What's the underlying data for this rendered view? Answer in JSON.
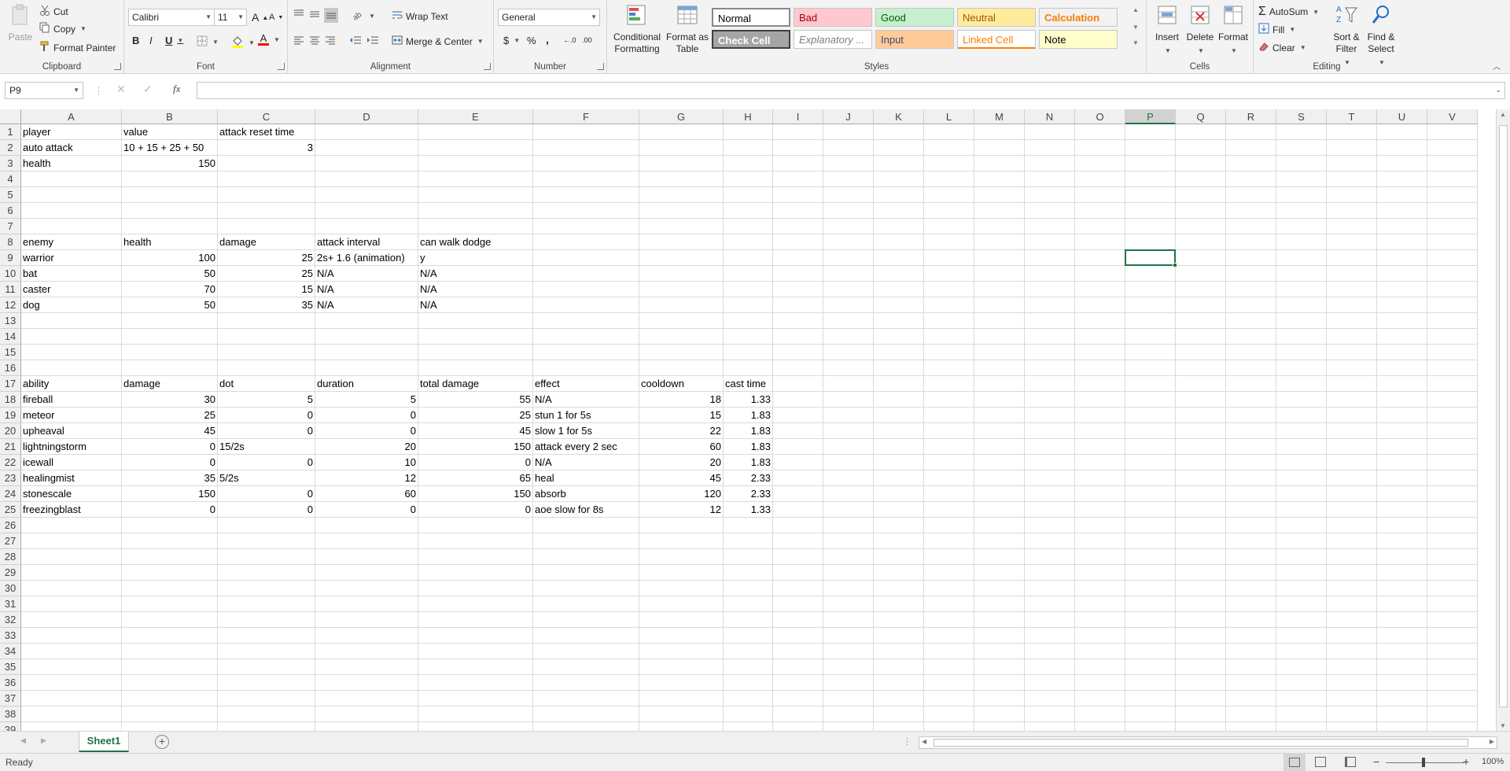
{
  "ribbon": {
    "clipboard": {
      "label": "Clipboard",
      "paste": "Paste",
      "cut": "Cut",
      "copy": "Copy",
      "format_painter": "Format Painter"
    },
    "font": {
      "label": "Font",
      "font_name": "Calibri",
      "font_size": "11",
      "bold": "B",
      "italic": "I",
      "underline": "U",
      "grow": "A",
      "shrink": "A",
      "font_color_glyph": "A"
    },
    "alignment": {
      "label": "Alignment",
      "wrap_text": "Wrap Text",
      "merge_center": "Merge & Center"
    },
    "number": {
      "label": "Number",
      "format": "General",
      "currency": "$",
      "percent": "%",
      "comma": ",",
      "inc_dec": "←.0",
      "dec_dec": ".00"
    },
    "styles": {
      "label": "Styles",
      "conditional": "Conditional Formatting",
      "format_table": "Format as Table",
      "cells": [
        {
          "name": "Normal",
          "bg": "#ffffff",
          "fg": "#000000"
        },
        {
          "name": "Bad",
          "bg": "#ffc7ce",
          "fg": "#9c0006"
        },
        {
          "name": "Good",
          "bg": "#c6efce",
          "fg": "#006100"
        },
        {
          "name": "Neutral",
          "bg": "#ffeb9c",
          "fg": "#9c5700"
        },
        {
          "name": "Calculation",
          "bg": "#f2f2f2",
          "fg": "#fa7d00"
        },
        {
          "name": "Check Cell",
          "bg": "#a5a5a5",
          "fg": "#ffffff"
        },
        {
          "name": "Explanatory ...",
          "bg": "#ffffff",
          "fg": "#7f7f7f"
        },
        {
          "name": "Input",
          "bg": "#ffcc99",
          "fg": "#3f3f76"
        },
        {
          "name": "Linked Cell",
          "bg": "#ffffff",
          "fg": "#fa7d00"
        },
        {
          "name": "Note",
          "bg": "#ffffcc",
          "fg": "#000000"
        }
      ]
    },
    "cells_group": {
      "label": "Cells",
      "insert": "Insert",
      "delete": "Delete",
      "format": "Format"
    },
    "editing": {
      "label": "Editing",
      "autosum": "AutoSum",
      "fill": "Fill",
      "clear": "Clear",
      "sort": "Sort & Filter",
      "find": "Find & Select"
    }
  },
  "formula_bar": {
    "name_box": "P9",
    "fx": "fx",
    "content": ""
  },
  "grid": {
    "columns": [
      "A",
      "B",
      "C",
      "D",
      "E",
      "F",
      "G",
      "H",
      "I",
      "J",
      "K",
      "L",
      "M",
      "N",
      "O",
      "P",
      "Q",
      "R",
      "S",
      "T",
      "U",
      "V"
    ],
    "selected_col": "P",
    "selected_cell": "P9",
    "rows": [
      "1",
      "2",
      "3",
      "4",
      "5",
      "6",
      "7",
      "8",
      "9",
      "10",
      "11",
      "12",
      "13",
      "14",
      "15",
      "16",
      "17",
      "18",
      "19",
      "20",
      "21",
      "22",
      "23",
      "24",
      "25",
      "26",
      "27",
      "28",
      "29",
      "30",
      "31",
      "32",
      "33",
      "34",
      "35",
      "36",
      "37",
      "38",
      "39"
    ],
    "cells": [
      {
        "r": 1,
        "c": "A",
        "v": "player"
      },
      {
        "r": 1,
        "c": "B",
        "v": "value"
      },
      {
        "r": 1,
        "c": "C",
        "v": "attack reset time"
      },
      {
        "r": 2,
        "c": "A",
        "v": "auto attack"
      },
      {
        "r": 2,
        "c": "B",
        "v": "10 +  15 + 25 + 50"
      },
      {
        "r": 2,
        "c": "C",
        "v": "3",
        "num": true
      },
      {
        "r": 3,
        "c": "A",
        "v": "health"
      },
      {
        "r": 3,
        "c": "B",
        "v": "150",
        "num": true
      },
      {
        "r": 8,
        "c": "A",
        "v": "enemy"
      },
      {
        "r": 8,
        "c": "B",
        "v": "health"
      },
      {
        "r": 8,
        "c": "C",
        "v": "damage"
      },
      {
        "r": 8,
        "c": "D",
        "v": "attack interval"
      },
      {
        "r": 8,
        "c": "E",
        "v": "can walk dodge"
      },
      {
        "r": 9,
        "c": "A",
        "v": "warrior"
      },
      {
        "r": 9,
        "c": "B",
        "v": "100",
        "num": true
      },
      {
        "r": 9,
        "c": "C",
        "v": "25",
        "num": true
      },
      {
        "r": 9,
        "c": "D",
        "v": "2s+ 1.6 (animation)"
      },
      {
        "r": 9,
        "c": "E",
        "v": "y"
      },
      {
        "r": 10,
        "c": "A",
        "v": "bat"
      },
      {
        "r": 10,
        "c": "B",
        "v": "50",
        "num": true
      },
      {
        "r": 10,
        "c": "C",
        "v": "25",
        "num": true
      },
      {
        "r": 10,
        "c": "D",
        "v": "N/A"
      },
      {
        "r": 10,
        "c": "E",
        "v": "N/A"
      },
      {
        "r": 11,
        "c": "A",
        "v": "caster"
      },
      {
        "r": 11,
        "c": "B",
        "v": "70",
        "num": true
      },
      {
        "r": 11,
        "c": "C",
        "v": "15",
        "num": true
      },
      {
        "r": 11,
        "c": "D",
        "v": "N/A"
      },
      {
        "r": 11,
        "c": "E",
        "v": "N/A"
      },
      {
        "r": 12,
        "c": "A",
        "v": "dog"
      },
      {
        "r": 12,
        "c": "B",
        "v": "50",
        "num": true
      },
      {
        "r": 12,
        "c": "C",
        "v": "35",
        "num": true
      },
      {
        "r": 12,
        "c": "D",
        "v": "N/A"
      },
      {
        "r": 12,
        "c": "E",
        "v": "N/A"
      },
      {
        "r": 17,
        "c": "A",
        "v": "ability"
      },
      {
        "r": 17,
        "c": "B",
        "v": "damage"
      },
      {
        "r": 17,
        "c": "C",
        "v": "dot"
      },
      {
        "r": 17,
        "c": "D",
        "v": "duration"
      },
      {
        "r": 17,
        "c": "E",
        "v": "total damage"
      },
      {
        "r": 17,
        "c": "F",
        "v": "effect"
      },
      {
        "r": 17,
        "c": "G",
        "v": "cooldown"
      },
      {
        "r": 17,
        "c": "H",
        "v": "cast time"
      },
      {
        "r": 18,
        "c": "A",
        "v": "fireball"
      },
      {
        "r": 18,
        "c": "B",
        "v": "30",
        "num": true
      },
      {
        "r": 18,
        "c": "C",
        "v": "5",
        "num": true
      },
      {
        "r": 18,
        "c": "D",
        "v": "5",
        "num": true
      },
      {
        "r": 18,
        "c": "E",
        "v": "55",
        "num": true
      },
      {
        "r": 18,
        "c": "F",
        "v": "N/A"
      },
      {
        "r": 18,
        "c": "G",
        "v": "18",
        "num": true
      },
      {
        "r": 18,
        "c": "H",
        "v": "1.33",
        "num": true
      },
      {
        "r": 19,
        "c": "A",
        "v": "meteor"
      },
      {
        "r": 19,
        "c": "B",
        "v": "25",
        "num": true
      },
      {
        "r": 19,
        "c": "C",
        "v": "0",
        "num": true
      },
      {
        "r": 19,
        "c": "D",
        "v": "0",
        "num": true
      },
      {
        "r": 19,
        "c": "E",
        "v": "25",
        "num": true
      },
      {
        "r": 19,
        "c": "F",
        "v": "stun 1 for 5s"
      },
      {
        "r": 19,
        "c": "G",
        "v": "15",
        "num": true
      },
      {
        "r": 19,
        "c": "H",
        "v": "1.83",
        "num": true
      },
      {
        "r": 20,
        "c": "A",
        "v": "upheaval"
      },
      {
        "r": 20,
        "c": "B",
        "v": "45",
        "num": true
      },
      {
        "r": 20,
        "c": "C",
        "v": "0",
        "num": true
      },
      {
        "r": 20,
        "c": "D",
        "v": "0",
        "num": true
      },
      {
        "r": 20,
        "c": "E",
        "v": "45",
        "num": true
      },
      {
        "r": 20,
        "c": "F",
        "v": "slow 1 for 5s"
      },
      {
        "r": 20,
        "c": "G",
        "v": "22",
        "num": true
      },
      {
        "r": 20,
        "c": "H",
        "v": "1.83",
        "num": true
      },
      {
        "r": 21,
        "c": "A",
        "v": "lightningstorm"
      },
      {
        "r": 21,
        "c": "B",
        "v": "0",
        "num": true
      },
      {
        "r": 21,
        "c": "C",
        "v": "15/2s"
      },
      {
        "r": 21,
        "c": "D",
        "v": "20",
        "num": true
      },
      {
        "r": 21,
        "c": "E",
        "v": "150",
        "num": true
      },
      {
        "r": 21,
        "c": "F",
        "v": "attack every 2 sec"
      },
      {
        "r": 21,
        "c": "G",
        "v": "60",
        "num": true
      },
      {
        "r": 21,
        "c": "H",
        "v": "1.83",
        "num": true
      },
      {
        "r": 22,
        "c": "A",
        "v": "icewall"
      },
      {
        "r": 22,
        "c": "B",
        "v": "0",
        "num": true
      },
      {
        "r": 22,
        "c": "C",
        "v": "0",
        "num": true
      },
      {
        "r": 22,
        "c": "D",
        "v": "10",
        "num": true
      },
      {
        "r": 22,
        "c": "E",
        "v": "0",
        "num": true
      },
      {
        "r": 22,
        "c": "F",
        "v": "N/A"
      },
      {
        "r": 22,
        "c": "G",
        "v": "20",
        "num": true
      },
      {
        "r": 22,
        "c": "H",
        "v": "1.83",
        "num": true
      },
      {
        "r": 23,
        "c": "A",
        "v": "healingmist"
      },
      {
        "r": 23,
        "c": "B",
        "v": "35",
        "num": true
      },
      {
        "r": 23,
        "c": "C",
        "v": "5/2s"
      },
      {
        "r": 23,
        "c": "D",
        "v": "12",
        "num": true
      },
      {
        "r": 23,
        "c": "E",
        "v": "65",
        "num": true
      },
      {
        "r": 23,
        "c": "F",
        "v": "heal"
      },
      {
        "r": 23,
        "c": "G",
        "v": "45",
        "num": true
      },
      {
        "r": 23,
        "c": "H",
        "v": "2.33",
        "num": true
      },
      {
        "r": 24,
        "c": "A",
        "v": "stonescale"
      },
      {
        "r": 24,
        "c": "B",
        "v": "150",
        "num": true
      },
      {
        "r": 24,
        "c": "C",
        "v": "0",
        "num": true
      },
      {
        "r": 24,
        "c": "D",
        "v": "60",
        "num": true
      },
      {
        "r": 24,
        "c": "E",
        "v": "150",
        "num": true
      },
      {
        "r": 24,
        "c": "F",
        "v": "absorb"
      },
      {
        "r": 24,
        "c": "G",
        "v": "120",
        "num": true
      },
      {
        "r": 24,
        "c": "H",
        "v": "2.33",
        "num": true
      },
      {
        "r": 25,
        "c": "A",
        "v": "freezingblast"
      },
      {
        "r": 25,
        "c": "B",
        "v": "0",
        "num": true
      },
      {
        "r": 25,
        "c": "C",
        "v": "0",
        "num": true
      },
      {
        "r": 25,
        "c": "D",
        "v": "0",
        "num": true
      },
      {
        "r": 25,
        "c": "E",
        "v": "0",
        "num": true
      },
      {
        "r": 25,
        "c": "F",
        "v": "aoe slow for 8s"
      },
      {
        "r": 25,
        "c": "G",
        "v": "12",
        "num": true
      },
      {
        "r": 25,
        "c": "H",
        "v": "1.33",
        "num": true
      }
    ]
  },
  "sheets": {
    "tabs": [
      "Sheet1"
    ],
    "add": "+"
  },
  "status": {
    "ready": "Ready",
    "zoom": "100%",
    "minus": "−",
    "plus": "+"
  },
  "colors": {
    "accent": "#217346"
  }
}
